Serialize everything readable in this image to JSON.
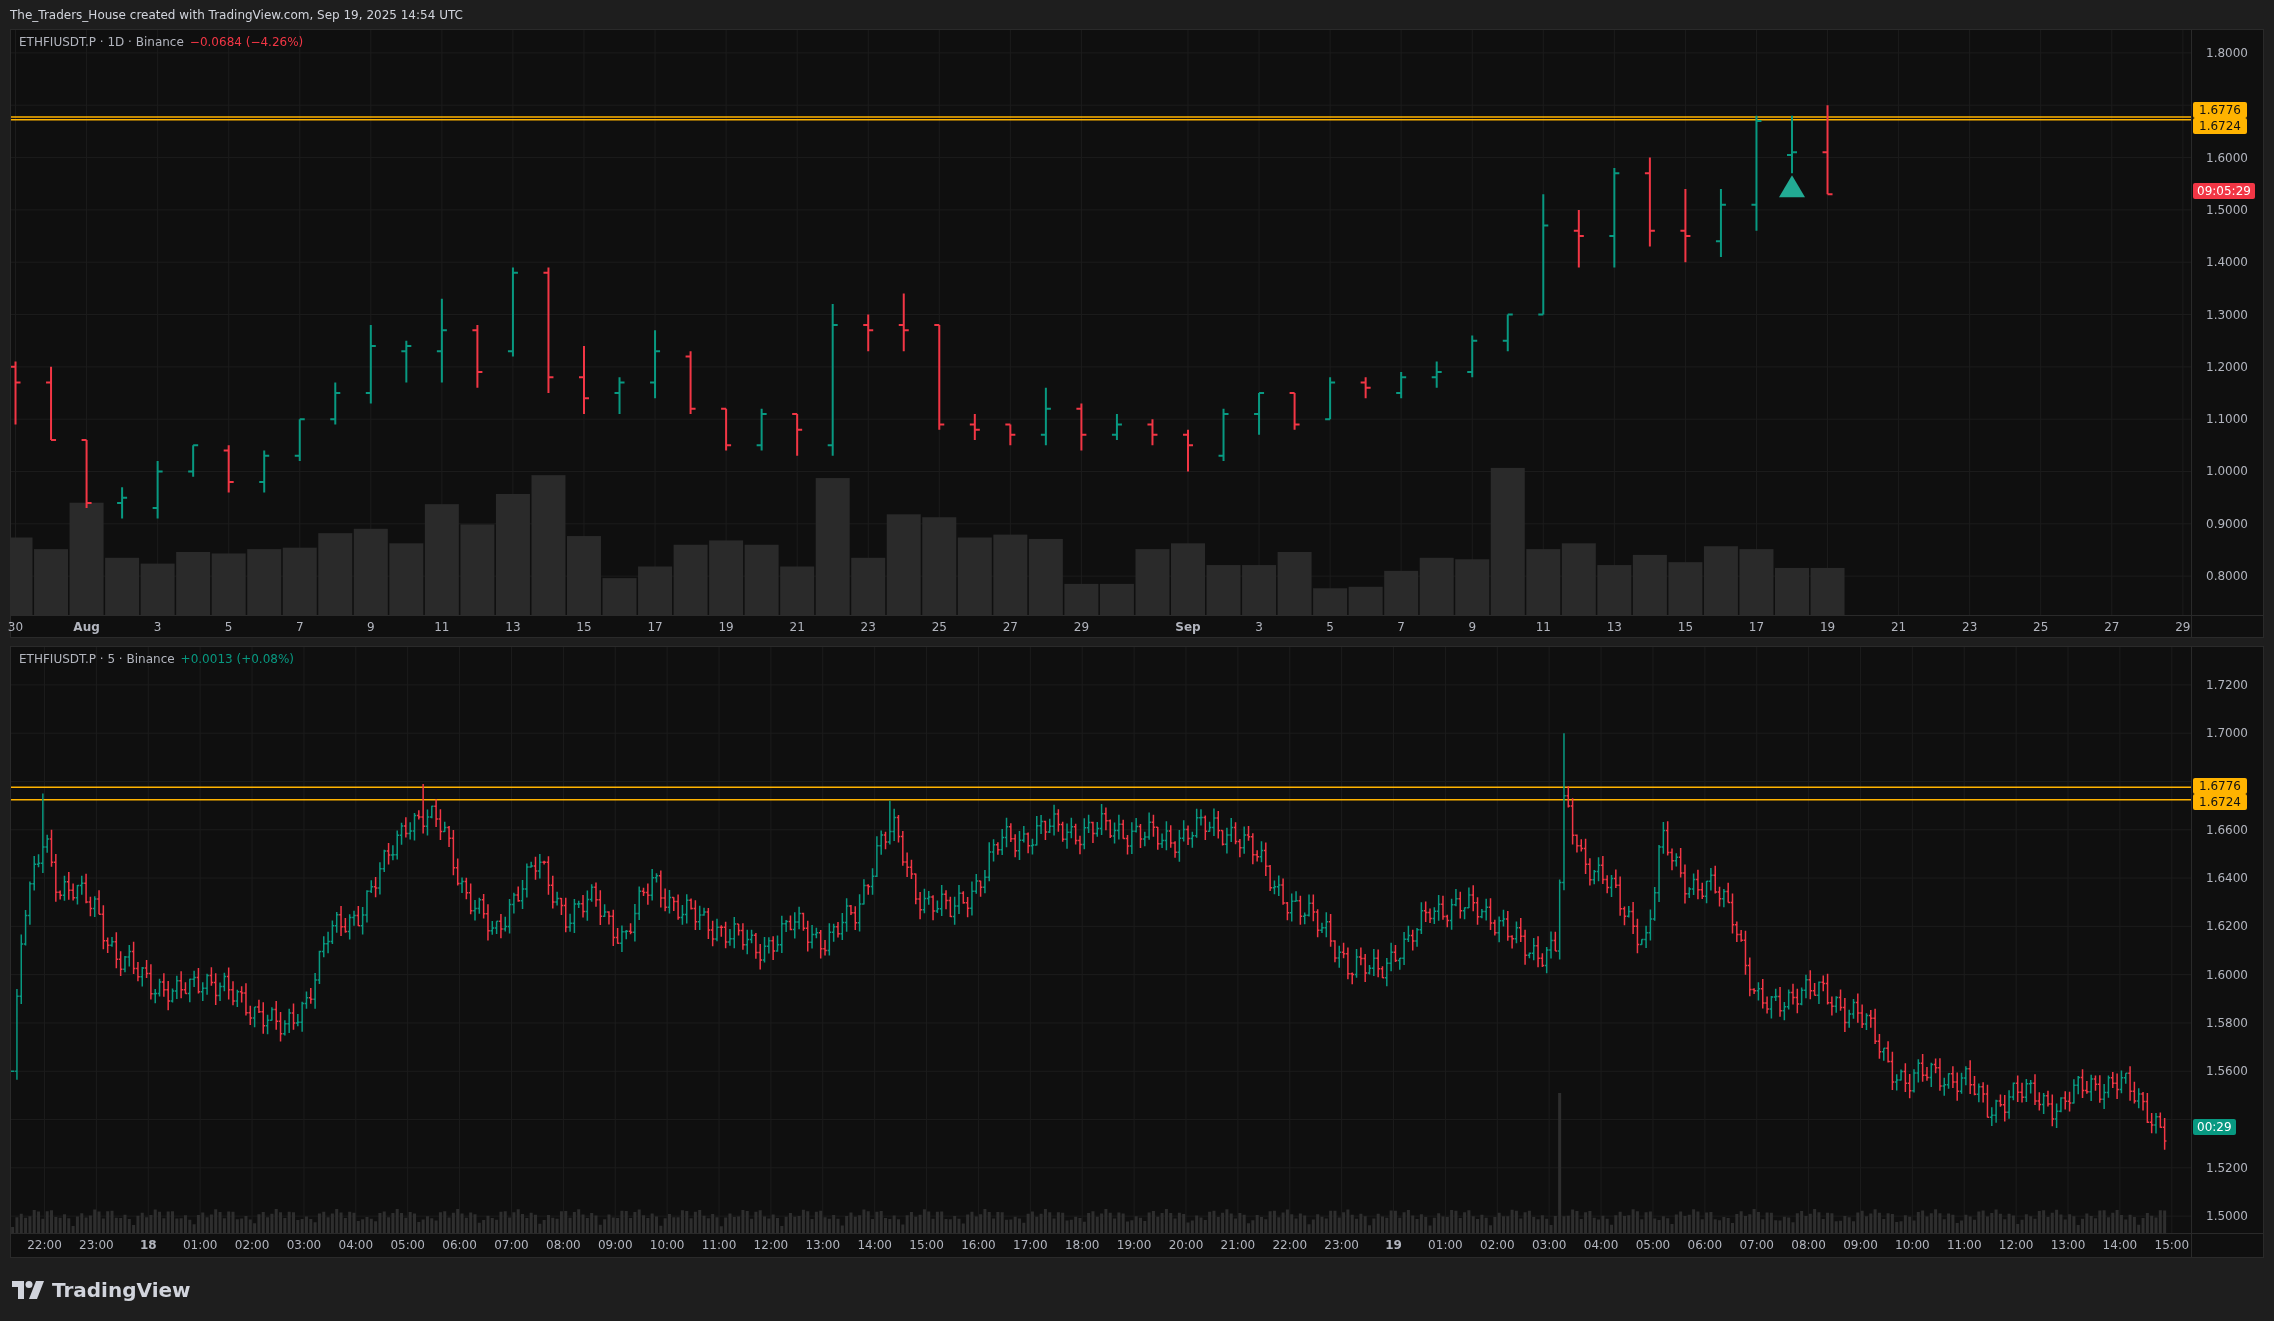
{
  "header": {
    "text": "The_Traders_House created with TradingView.com, Sep 19, 2025 14:54 UTC"
  },
  "panes": [
    {
      "kind": "daily",
      "symbol": "ETHFIUSDT.P · 1D · Binance",
      "change": {
        "text": "−0.0684 (−4.26%)",
        "negative": true
      },
      "price_labels": [
        "1.8000",
        "1.6000",
        "1.5000",
        "1.4000",
        "1.3000",
        "1.2000",
        "1.1000",
        "1.0000",
        "0.9000",
        "0.8000"
      ],
      "time_labels": [
        {
          "label": "30",
          "kind": "minor"
        },
        {
          "label": "Aug",
          "kind": "major"
        },
        {
          "label": "3",
          "kind": "minor"
        },
        {
          "label": "5",
          "kind": "minor"
        },
        {
          "label": "7",
          "kind": "minor"
        },
        {
          "label": "9",
          "kind": "minor"
        },
        {
          "label": "11",
          "kind": "minor"
        },
        {
          "label": "13",
          "kind": "minor"
        },
        {
          "label": "15",
          "kind": "minor"
        },
        {
          "label": "17",
          "kind": "minor"
        },
        {
          "label": "19",
          "kind": "minor"
        },
        {
          "label": "21",
          "kind": "minor"
        },
        {
          "label": "23",
          "kind": "minor"
        },
        {
          "label": "25",
          "kind": "minor"
        },
        {
          "label": "27",
          "kind": "minor"
        },
        {
          "label": "29",
          "kind": "minor"
        },
        {
          "label": "Sep",
          "kind": "major"
        },
        {
          "label": "3",
          "kind": "minor"
        },
        {
          "label": "5",
          "kind": "minor"
        },
        {
          "label": "7",
          "kind": "minor"
        },
        {
          "label": "9",
          "kind": "minor"
        },
        {
          "label": "11",
          "kind": "minor"
        },
        {
          "label": "13",
          "kind": "minor"
        },
        {
          "label": "15",
          "kind": "minor"
        },
        {
          "label": "17",
          "kind": "minor"
        },
        {
          "label": "19",
          "kind": "minor"
        },
        {
          "label": "21",
          "kind": "minor"
        },
        {
          "label": "23",
          "kind": "minor"
        },
        {
          "label": "25",
          "kind": "minor"
        },
        {
          "label": "27",
          "kind": "minor"
        },
        {
          "label": "29",
          "kind": "minor"
        }
      ],
      "levels": [
        {
          "label": "1.6776"
        },
        {
          "label": "1.6724"
        }
      ],
      "countdown": {
        "text": "09:05:29",
        "negative": true
      }
    },
    {
      "kind": "intraday",
      "symbol": "ETHFIUSDT.P · 5 · Binance",
      "change": {
        "text": "+0.0013 (+0.08%)",
        "negative": false
      },
      "price_labels": [
        "1.7200",
        "1.7000",
        "1.6600",
        "1.6400",
        "1.6200",
        "1.6000",
        "1.5800",
        "1.5600",
        "1.5200",
        "1.5000"
      ],
      "time_labels": [
        {
          "label": "22:00",
          "kind": "minor"
        },
        {
          "label": "23:00",
          "kind": "minor"
        },
        {
          "label": "18",
          "kind": "major"
        },
        {
          "label": "01:00",
          "kind": "minor"
        },
        {
          "label": "02:00",
          "kind": "minor"
        },
        {
          "label": "03:00",
          "kind": "minor"
        },
        {
          "label": "04:00",
          "kind": "minor"
        },
        {
          "label": "05:00",
          "kind": "minor"
        },
        {
          "label": "06:00",
          "kind": "minor"
        },
        {
          "label": "07:00",
          "kind": "minor"
        },
        {
          "label": "08:00",
          "kind": "minor"
        },
        {
          "label": "09:00",
          "kind": "minor"
        },
        {
          "label": "10:00",
          "kind": "minor"
        },
        {
          "label": "11:00",
          "kind": "minor"
        },
        {
          "label": "12:00",
          "kind": "minor"
        },
        {
          "label": "13:00",
          "kind": "minor"
        },
        {
          "label": "14:00",
          "kind": "minor"
        },
        {
          "label": "15:00",
          "kind": "minor"
        },
        {
          "label": "16:00",
          "kind": "minor"
        },
        {
          "label": "17:00",
          "kind": "minor"
        },
        {
          "label": "18:00",
          "kind": "minor"
        },
        {
          "label": "19:00",
          "kind": "minor"
        },
        {
          "label": "20:00",
          "kind": "minor"
        },
        {
          "label": "21:00",
          "kind": "minor"
        },
        {
          "label": "22:00",
          "kind": "minor"
        },
        {
          "label": "23:00",
          "kind": "minor"
        },
        {
          "label": "19",
          "kind": "major"
        },
        {
          "label": "01:00",
          "kind": "minor"
        },
        {
          "label": "02:00",
          "kind": "minor"
        },
        {
          "label": "03:00",
          "kind": "minor"
        },
        {
          "label": "04:00",
          "kind": "minor"
        },
        {
          "label": "05:00",
          "kind": "minor"
        },
        {
          "label": "06:00",
          "kind": "minor"
        },
        {
          "label": "07:00",
          "kind": "minor"
        },
        {
          "label": "08:00",
          "kind": "minor"
        },
        {
          "label": "09:00",
          "kind": "minor"
        },
        {
          "label": "10:00",
          "kind": "minor"
        },
        {
          "label": "11:00",
          "kind": "minor"
        },
        {
          "label": "12:00",
          "kind": "minor"
        },
        {
          "label": "13:00",
          "kind": "minor"
        },
        {
          "label": "14:00",
          "kind": "minor"
        },
        {
          "label": "15:00",
          "kind": "minor"
        }
      ],
      "levels": [
        {
          "label": "1.6776"
        },
        {
          "label": "1.6724"
        }
      ],
      "countdown": {
        "text": "00:29",
        "negative": false
      }
    }
  ],
  "footer": {
    "brand": "TradingView"
  }
}
